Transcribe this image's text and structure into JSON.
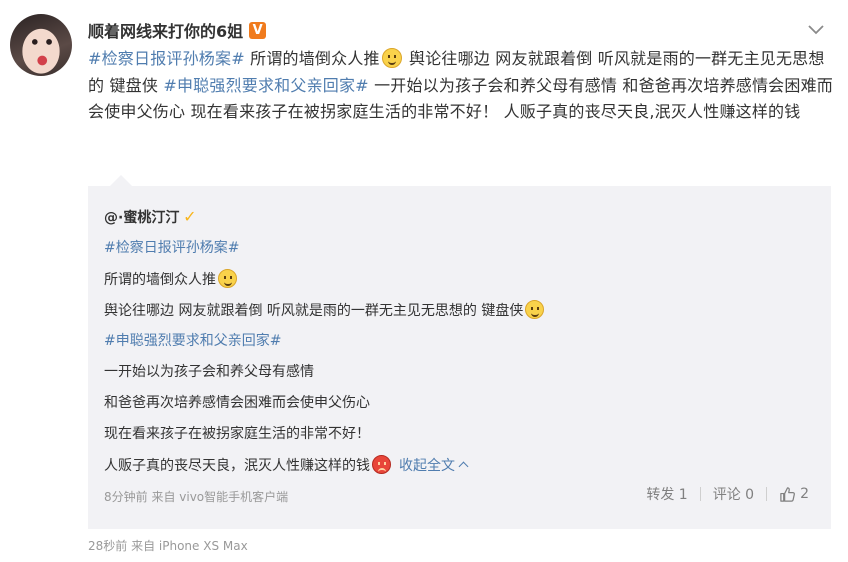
{
  "post": {
    "author": "顺着网线来打你的6姐",
    "verified_badge": "V",
    "text_segments": [
      {
        "type": "topic",
        "text": "#检察日报评孙杨案#"
      },
      {
        "type": "text",
        "text": " 所谓的墙倒众人推"
      },
      {
        "type": "emoji",
        "name": "smile-emoji"
      },
      {
        "type": "text",
        "text": " 舆论往哪边 网友就跟着倒 听风就是雨的一群无主见无思想的 键盘侠 "
      },
      {
        "type": "topic",
        "text": "#申聪强烈要求和父亲回家#"
      },
      {
        "type": "text",
        "text": " 一开始以为孩子会和养父母有感情 和爸爸再次培养感情会困难而会使申父伤心 现在看来孩子在被拐家庭生活的非常不好！ 人贩子真的丧尽天良,泯灭人性赚这样的钱"
      }
    ],
    "meta": "28秒前  来自 iPhone XS Max"
  },
  "repost": {
    "author": "@·蜜桃汀汀",
    "lines": [
      {
        "topic": "#检察日报评孙杨案#"
      },
      {
        "text": "所谓的墙倒众人推",
        "emoji": "smile-emoji"
      },
      {
        "text": "舆论往哪边 网友就跟着倒 听风就是雨的一群无主见无思想的 键盘侠",
        "emoji": "smile-emoji"
      },
      {
        "topic": "#申聪强烈要求和父亲回家#"
      },
      {
        "text": "一开始以为孩子会和养父母有感情"
      },
      {
        "text": "和爸爸再次培养感情会困难而会使申父伤心"
      },
      {
        "text": "现在看来孩子在被拐家庭生活的非常不好！"
      },
      {
        "text": "人贩子真的丧尽天良，泯灭人性赚这样的钱",
        "emoji": "angry-emoji"
      }
    ],
    "collapse_label": "收起全文",
    "meta": "8分钟前  来自 vivo智能手机客户端",
    "actions": {
      "repost": "转发 1",
      "comment": "评论 0",
      "like": "2"
    }
  },
  "icons": {
    "menu": "chevron-down-icon",
    "like": "thumbs-up-icon",
    "collapse": "chevron-up-icon"
  },
  "colors": {
    "topic_link": "#507daf",
    "verified_orange": "#f07b1d",
    "repost_bg": "#f2f2f5",
    "meta_gray": "#999999"
  }
}
